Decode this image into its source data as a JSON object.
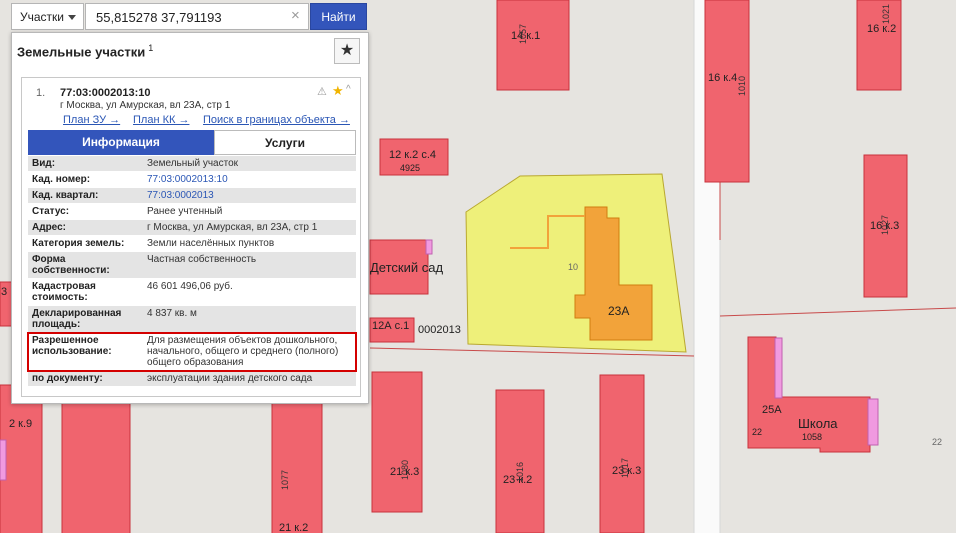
{
  "search": {
    "category": "Участки",
    "value": "55,815278 37,791193",
    "clear": "×",
    "button": "Найти"
  },
  "panel": {
    "title": "Земельные участки",
    "title_sup": "1",
    "star": "★",
    "card": {
      "index": "1.",
      "cad_number": "77:03:0002013:10",
      "address": "г Москва, ул Амурская, вл 23А, стр 1",
      "warn": "⚠",
      "fav": "★",
      "collapse": "^",
      "links": [
        "План ЗУ →",
        "План КК →",
        "Поиск в границах объекта →"
      ],
      "tabs": [
        "Информация",
        "Услуги"
      ],
      "rows": [
        {
          "k": "Вид:",
          "v": "Земельный участок"
        },
        {
          "k": "Кад. номер:",
          "v": "77:03:0002013:10"
        },
        {
          "k": "Кад. квартал:",
          "v": "77:03:0002013"
        },
        {
          "k": "Статус:",
          "v": "Ранее учтенный"
        },
        {
          "k": "Адрес:",
          "v": "г Москва, ул Амурская, вл 23А, стр 1"
        },
        {
          "k": "Категория земель:",
          "v": "Земли населённых пунктов"
        },
        {
          "k": "Форма собственности:",
          "v": "Частная собственность"
        },
        {
          "k": "Кадастровая стоимость:",
          "v": "46 601 496,06 руб."
        },
        {
          "k": "Декларированная площадь:",
          "v": "4 837 кв. м"
        },
        {
          "k": "Разрешенное использование:",
          "v": "Для размещения объектов дошкольного, начального, общего и среднего (полного) общего образования"
        },
        {
          "k": "по документу:",
          "v": "эксплуатации здания детского сада"
        }
      ]
    }
  },
  "map": {
    "labels": {
      "b14k1": "14 к.1",
      "b16k4": "16 к.4",
      "b16k2": "16 к.2",
      "b16k3": "16 к.3",
      "b12k2s4": "12 к.2 с.4",
      "n4925": "4925",
      "detsad": "Детский сад",
      "n10": "10",
      "b23a": "23А",
      "b12a": "12А с.1",
      "n0002013": "0002013",
      "b25a": "25А",
      "shkola": "Школа",
      "n1058": "1058",
      "n22a": "22",
      "n22b": "22",
      "b21k3": "21 к.3",
      "b23k2": "23 к.2",
      "b23k3": "23 к.3",
      "b21k2": "21 к.2",
      "b2k9": "2 к.9",
      "n3": "3",
      "v1021": "1021",
      "v1077": "1077",
      "v1010": "1010",
      "v1080": "1080",
      "v1017": "1017",
      "v1016": "1016",
      "v1057": "1057",
      "v1027": "1027"
    }
  },
  "colors": {
    "building": "#f0646e",
    "building_stroke": "#c8323c",
    "parcel": "#eef07a",
    "target": "#f2a33a",
    "accent": "#3355bb",
    "highlight": "#d40000"
  }
}
